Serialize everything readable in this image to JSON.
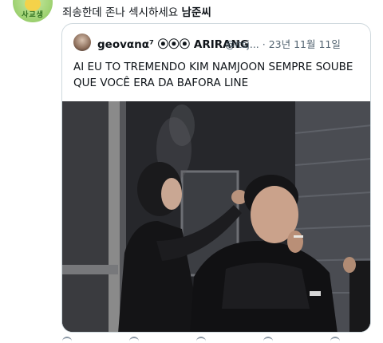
{
  "reply": {
    "text_prefix": "죄송한데 존나 섹시하세요",
    "text_name": "남준씨",
    "avatar_caption": "사교생"
  },
  "quoted_post": {
    "display_name": "geovαnα⁷ ⦿⦿⦿ ARIRANG",
    "handle_date": "@itsj... · 23년 11월 11일",
    "body": "AI EU TO TREMENDO KIM NAMJOON SEMPRE SOUBE QUE VOCÊ ERA DA BAFORA LINE"
  },
  "icons": {
    "action_icons": [
      "reply-icon",
      "repost-icon",
      "like-icon",
      "views-icon",
      "bookmark-icon",
      "share-icon"
    ]
  },
  "colors": {
    "text_primary": "#0f1419",
    "text_secondary": "#536471",
    "border": "#cfd9de"
  }
}
